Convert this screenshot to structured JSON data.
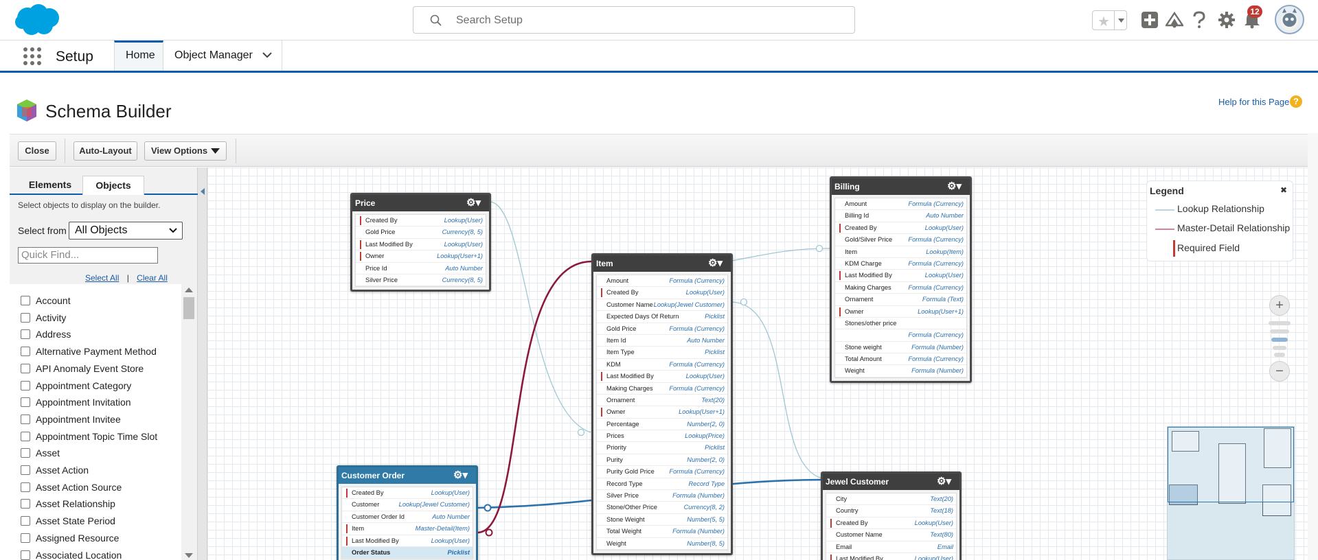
{
  "header": {
    "search_placeholder": "Search Setup",
    "notification_count": "12",
    "icons": [
      "salesforce-logo",
      "search-icon",
      "favorites-star-icon",
      "add-icon",
      "trailhead-icon",
      "help-icon",
      "gear-icon",
      "notification-bell-icon",
      "avatar"
    ]
  },
  "nav": {
    "app_name": "Setup",
    "tabs": [
      {
        "label": "Home"
      },
      {
        "label": "Object Manager"
      }
    ]
  },
  "page": {
    "title": "Schema Builder",
    "help_link": "Help for this Page"
  },
  "toolbar": {
    "close_label": "Close",
    "auto_layout_label": "Auto-Layout",
    "view_options_label": "View Options"
  },
  "left_panel": {
    "tabs": [
      {
        "label": "Elements"
      },
      {
        "label": "Objects"
      }
    ],
    "description": "Select objects to display on the builder.",
    "select_from_label": "Select from",
    "select_from_value": "All Objects",
    "quick_find_placeholder": "Quick Find...",
    "select_all": "Select All",
    "separator": "|",
    "clear_all": "Clear All",
    "objects": [
      "Account",
      "Activity",
      "Address",
      "Alternative Payment Method",
      "API Anomaly Event Store",
      "Appointment Category",
      "Appointment Invitation",
      "Appointment Invitee",
      "Appointment Topic Time Slot",
      "Asset",
      "Asset Action",
      "Asset Action Source",
      "Asset Relationship",
      "Asset State Period",
      "Assigned Resource",
      "Associated Location"
    ]
  },
  "entities": [
    {
      "name": "Price",
      "fields": [
        {
          "label": "Created By",
          "type": "Lookup(User)",
          "req": true
        },
        {
          "label": "Gold Price",
          "type": "Currency(8, 5)",
          "req": false
        },
        {
          "label": "Last Modified By",
          "type": "Lookup(User)",
          "req": true
        },
        {
          "label": "Owner",
          "type": "Lookup(User+1)",
          "req": true
        },
        {
          "label": "Price Id",
          "type": "Auto Number",
          "req": false
        },
        {
          "label": "Silver Price",
          "type": "Currency(8, 5)",
          "req": false
        }
      ]
    },
    {
      "name": "Item",
      "fields": [
        {
          "label": "Amount",
          "type": "Formula (Currency)",
          "req": false
        },
        {
          "label": "Created By",
          "type": "Lookup(User)",
          "req": true
        },
        {
          "label": "Customer Name",
          "type": "Lookup(Jewel Customer)",
          "req": false
        },
        {
          "label": "Expected Days Of Return",
          "type": "Picklist",
          "req": false
        },
        {
          "label": "Gold Price",
          "type": "Formula (Currency)",
          "req": false
        },
        {
          "label": "Item Id",
          "type": "Auto Number",
          "req": false
        },
        {
          "label": "Item Type",
          "type": "Picklist",
          "req": false
        },
        {
          "label": "KDM",
          "type": "Formula (Currency)",
          "req": false
        },
        {
          "label": "Last Modified By",
          "type": "Lookup(User)",
          "req": true
        },
        {
          "label": "Making Charges",
          "type": "Formula (Currency)",
          "req": false
        },
        {
          "label": "Ornament",
          "type": "Text(20)",
          "req": false
        },
        {
          "label": "Owner",
          "type": "Lookup(User+1)",
          "req": true
        },
        {
          "label": "Percentage",
          "type": "Number(2, 0)",
          "req": false
        },
        {
          "label": "Prices",
          "type": "Lookup(Price)",
          "req": false
        },
        {
          "label": "Priority",
          "type": "Picklist",
          "req": false
        },
        {
          "label": "Purity",
          "type": "Number(2, 0)",
          "req": false
        },
        {
          "label": "Purity Gold Price",
          "type": "Formula (Currency)",
          "req": false
        },
        {
          "label": "Record Type",
          "type": "Record Type",
          "req": false
        },
        {
          "label": "Silver Price",
          "type": "Formula (Number)",
          "req": false
        },
        {
          "label": "Stone/Other Price",
          "type": "Currency(8, 2)",
          "req": false
        },
        {
          "label": "Stone Weight",
          "type": "Number(5, 5)",
          "req": false
        },
        {
          "label": "Total Weight",
          "type": "Formula (Number)",
          "req": false
        },
        {
          "label": "Weight",
          "type": "Number(8, 5)",
          "req": false
        }
      ]
    },
    {
      "name": "Billing",
      "fields": [
        {
          "label": "Amount",
          "type": "Formula (Currency)",
          "req": false
        },
        {
          "label": "Billing Id",
          "type": "Auto Number",
          "req": false
        },
        {
          "label": "Created By",
          "type": "Lookup(User)",
          "req": true
        },
        {
          "label": "Gold/Silver Price",
          "type": "Formula (Currency)",
          "req": false
        },
        {
          "label": "Item",
          "type": "Lookup(Item)",
          "req": false
        },
        {
          "label": "KDM Charge",
          "type": "Formula (Currency)",
          "req": false
        },
        {
          "label": "Last Modified By",
          "type": "Lookup(User)",
          "req": true
        },
        {
          "label": "Making Charges",
          "type": "Formula (Currency)",
          "req": false
        },
        {
          "label": "Ornament",
          "type": "Formula (Text)",
          "req": false
        },
        {
          "label": "Owner",
          "type": "Lookup(User+1)",
          "req": true
        },
        {
          "label": "Stones/other price",
          "type": "",
          "req": false
        },
        {
          "label": "",
          "type": "Formula (Currency)",
          "req": false
        },
        {
          "label": "Stone weight",
          "type": "Formula (Number)",
          "req": false
        },
        {
          "label": "Total Amount",
          "type": "Formula (Currency)",
          "req": false
        },
        {
          "label": "Weight",
          "type": "Formula (Number)",
          "req": false
        }
      ]
    },
    {
      "name": "Customer Order",
      "fields": [
        {
          "label": "Created By",
          "type": "Lookup(User)",
          "req": true
        },
        {
          "label": "Customer",
          "type": "Lookup(Jewel Customer)",
          "req": false
        },
        {
          "label": "Customer Order Id",
          "type": "Auto Number",
          "req": false
        },
        {
          "label": "Item",
          "type": "Master-Detail(Item)",
          "req": true
        },
        {
          "label": "Last Modified By",
          "type": "Lookup(User)",
          "req": true
        },
        {
          "label": "Order Status",
          "type": "Picklist",
          "req": false,
          "hl": true
        }
      ]
    },
    {
      "name": "Jewel Customer",
      "fields": [
        {
          "label": "City",
          "type": "Text(20)",
          "req": false
        },
        {
          "label": "Country",
          "type": "Text(18)",
          "req": false
        },
        {
          "label": "Created By",
          "type": "Lookup(User)",
          "req": true
        },
        {
          "label": "Customer Name",
          "type": "Text(80)",
          "req": false
        },
        {
          "label": "Email",
          "type": "Email",
          "req": false
        },
        {
          "label": "Last Modified By",
          "type": "Lookup(User)",
          "req": true
        }
      ]
    }
  ],
  "legend": {
    "title": "Legend",
    "close": "✖",
    "items": [
      "Lookup Relationship",
      "Master-Detail Relationship",
      "Required Field"
    ],
    "colors": {
      "lookup": "#9fc7d3",
      "master_detail": "#8b1a3a",
      "required": "#c23934"
    }
  },
  "zoom": {
    "in_label": "+",
    "out_label": "−"
  }
}
